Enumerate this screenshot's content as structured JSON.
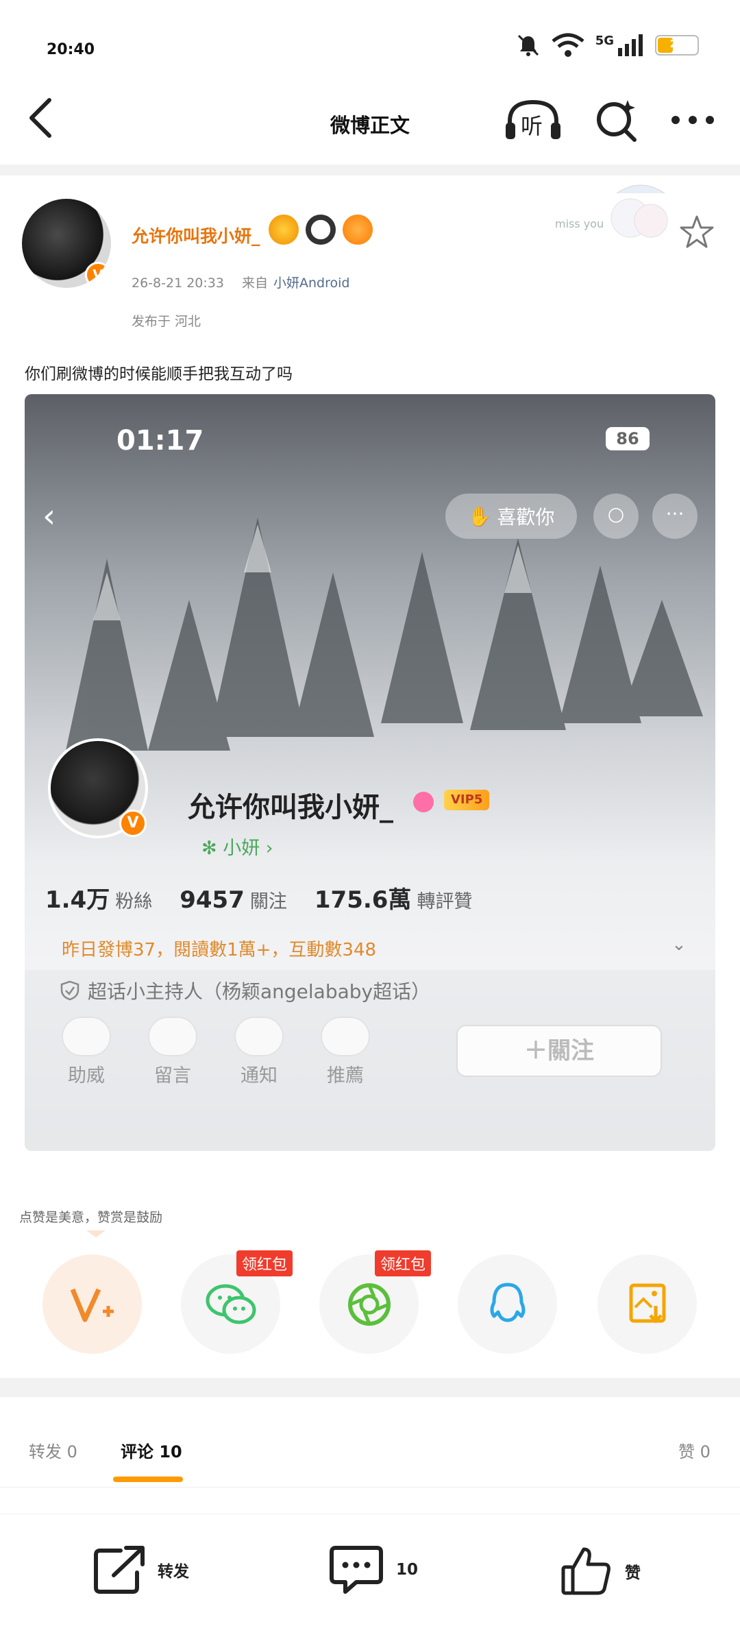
{
  "status_bar": {
    "time": "20:40",
    "network": "5G",
    "battery": "23"
  },
  "nav": {
    "title": "微博正文",
    "listen_label": "听"
  },
  "post": {
    "username": "允许你叫我小妍_",
    "verified_badge": "V",
    "date": "26-8-21 20:33",
    "from_prefix": "来自",
    "source": "小妍Android",
    "location": "发布于 河北",
    "text": "你们刷微博的时候能顺手把我互动了吗"
  },
  "screenshot": {
    "time": "01:17",
    "battery": "86",
    "like_button": "喜歡你",
    "name": "允许你叫我小妍_",
    "vip": "VIP5",
    "subtitle": "小妍 ›",
    "fans_num": "1.4万",
    "fans_label": "粉絲",
    "follow_num": "9457",
    "follow_label": "關注",
    "likes_num": "175.6萬",
    "likes_label": "轉評贊",
    "stats_line": "昨日發博37，閱讀數1萬+，互動數348",
    "supertopic": "超话小主持人（杨颖angelababy超话）",
    "shortcuts": [
      "助威",
      "留言",
      "通知",
      "推薦"
    ],
    "follow_button": "＋關注"
  },
  "reward_tip": "点赞是美意，赞赏是鼓励",
  "share": {
    "red_tag": "领红包"
  },
  "tabs": {
    "repost": "转发",
    "repost_count": "0",
    "comment": "评论",
    "comment_count": "10",
    "like": "赞",
    "like_count": "0"
  },
  "bottom_bar": {
    "repost": "转发",
    "comment_count": "10",
    "like": "赞"
  },
  "colors": {
    "accent": "#ff8200",
    "username": "#e8740c",
    "tab_underline": "#ff9a00",
    "red_tag": "#f03c2d",
    "wechat": "#3ec46d",
    "qq": "#2aa7e8"
  }
}
